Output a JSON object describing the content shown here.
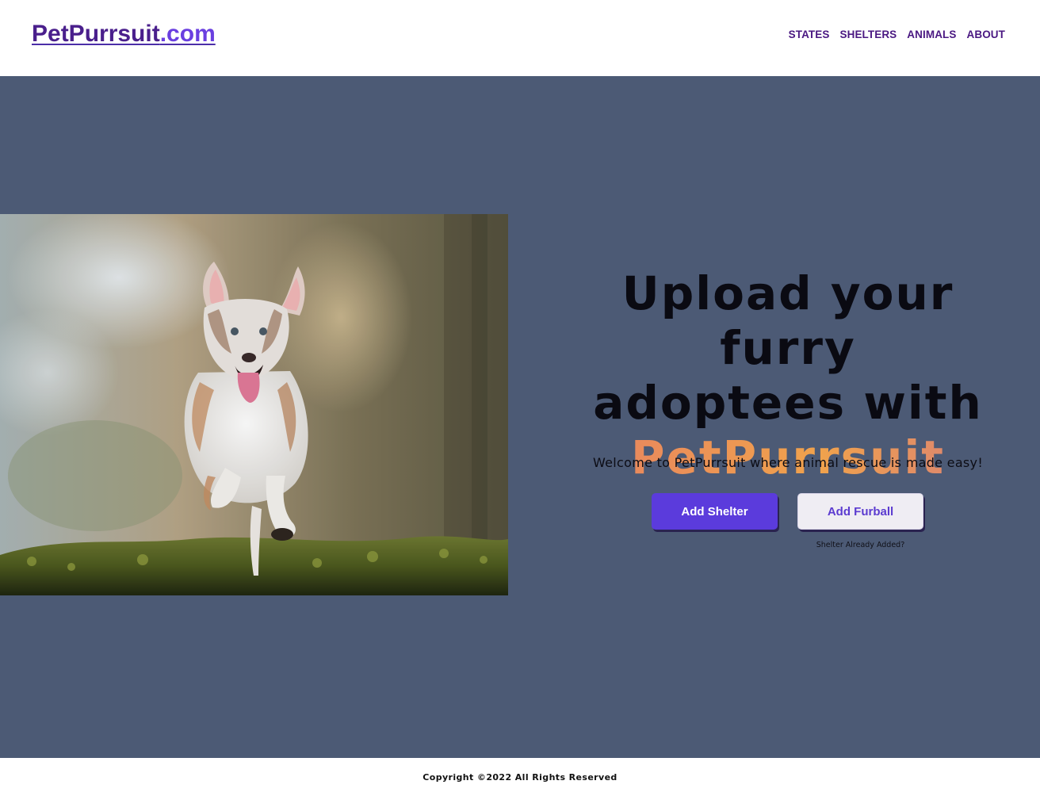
{
  "header": {
    "logo_brand": "PetPurrsuit",
    "logo_tld": ".com",
    "nav": [
      "STATES",
      "SHELTERS",
      "ANIMALS",
      "ABOUT"
    ]
  },
  "hero": {
    "headline_line1": "Upload your furry",
    "headline_line2": "adoptees with",
    "headline_accent": "PetPurrsuit",
    "welcome": "Welcome to PetPurrsuit where animal rescue is made easy!",
    "add_shelter_label": "Add Shelter",
    "add_furball_label": "Add Furball",
    "shelter_added_link": "Shelter Already Added?",
    "image_alt": "running-dog-photo"
  },
  "footer": {
    "copyright": "Copyright ©2022 All Rights Reserved"
  },
  "colors": {
    "hero_bg": "#4c5a75",
    "primary_button": "#5b3bdc",
    "accent_gradient_start": "#e98a5c",
    "accent_gradient_end": "#f0a24c",
    "nav_text": "#4a1882"
  }
}
